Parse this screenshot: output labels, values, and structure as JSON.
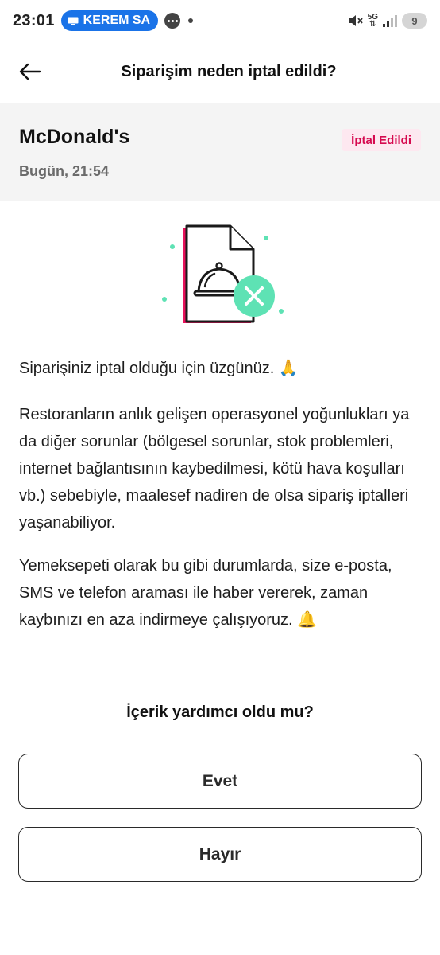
{
  "status_bar": {
    "time": "23:01",
    "cast_label": "KEREM SA",
    "network_tag_top": "5G",
    "battery_level": "9"
  },
  "header": {
    "title": "Siparişim neden iptal edildi?"
  },
  "order": {
    "restaurant": "McDonald's",
    "time": "Bugün, 21:54",
    "status": "İptal Edildi",
    "status_color": "#d6094f"
  },
  "content": {
    "para1": "Siparişiniz iptal olduğu için üzgünüz. 🙏",
    "para2": "Restoranların anlık gelişen operasyonel yoğunlukları ya da diğer sorunlar (bölgesel sorunlar, stok problemleri, internet bağlantısının kaybedilmesi, kötü hava koşulları vb.) sebebiyle, maalesef nadiren de olsa sipariş iptalleri yaşanabiliyor.",
    "para3": "Yemeksepeti olarak bu gibi durumlarda, size e-posta, SMS ve telefon araması ile haber vererek, zaman kaybınızı en aza indirmeye çalışıyoruz. 🔔"
  },
  "feedback": {
    "question": "İçerik yardımcı oldu mu?",
    "yes_label": "Evet",
    "no_label": "Hayır"
  },
  "colors": {
    "accent_pink": "#d6094f",
    "illustration_mint": "#5ee2b4"
  }
}
